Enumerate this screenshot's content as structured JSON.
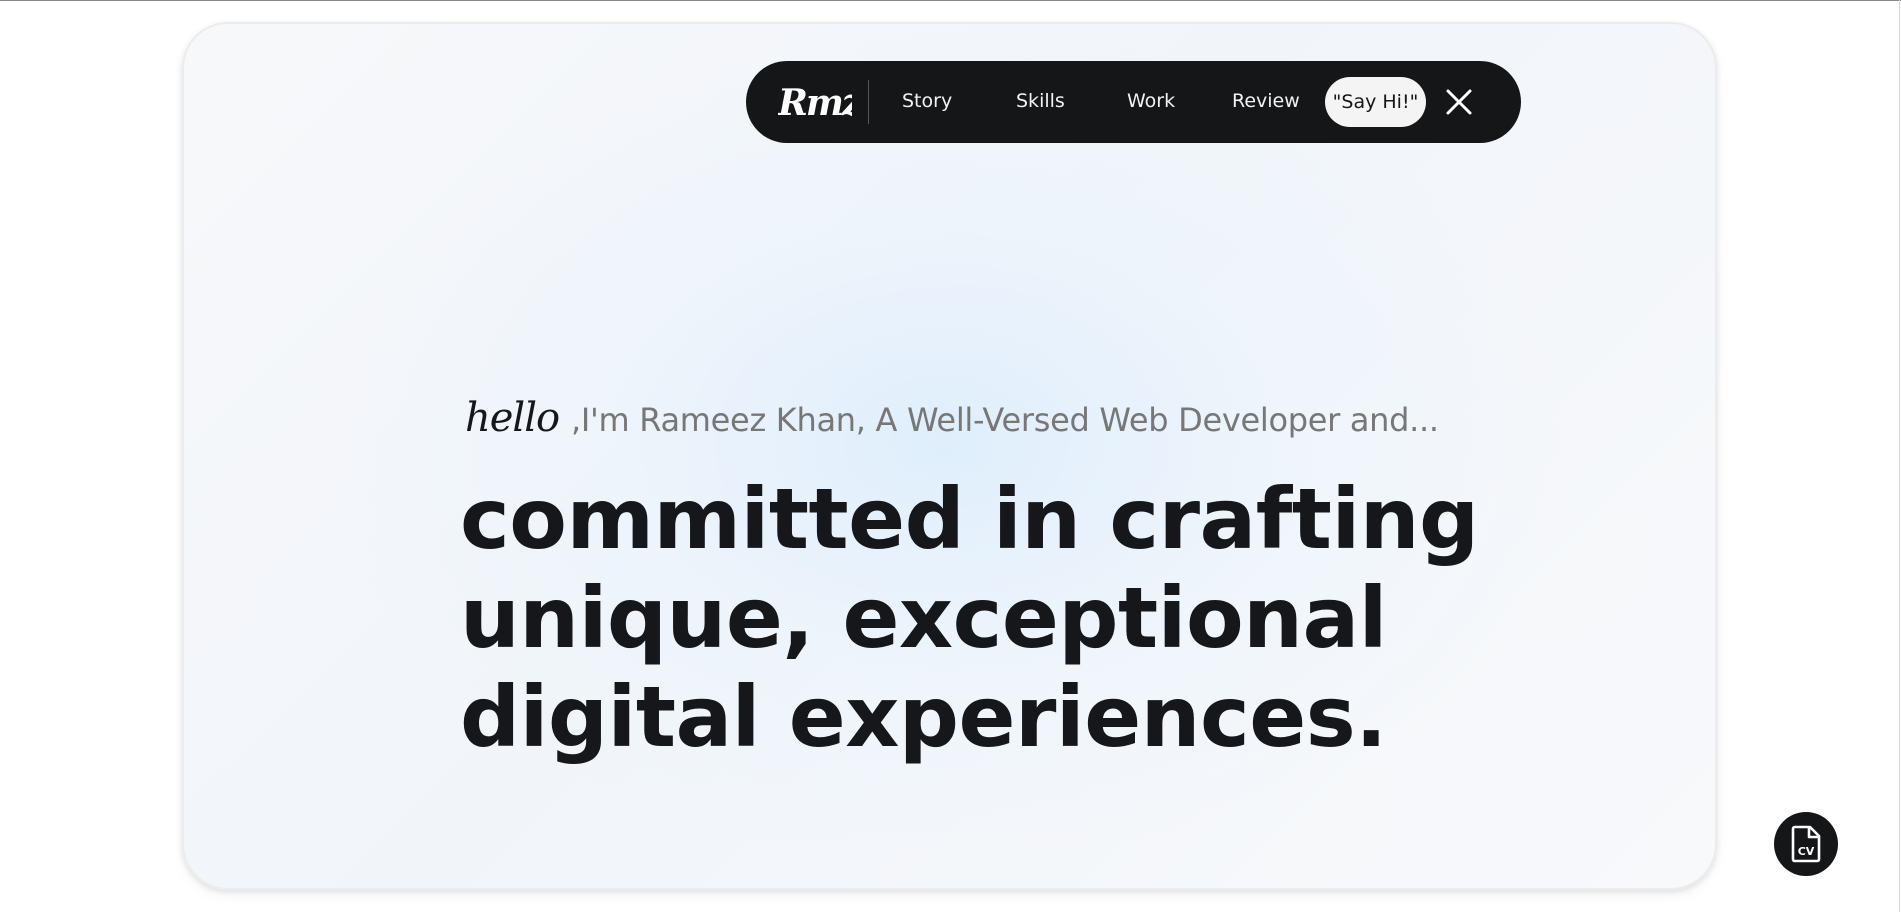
{
  "nav": {
    "logo_text": "Rmz",
    "items": [
      {
        "label": "Story"
      },
      {
        "label": "Skills"
      },
      {
        "label": "Work"
      },
      {
        "label": "Review"
      }
    ],
    "cta_label": "\"Say Hi!\"",
    "close_icon": "close-icon"
  },
  "hero": {
    "greeting_script": "hello",
    "intro": ",I'm Rameez Khan, A Well-Versed Web Developer and...",
    "headline": [
      "committed in crafting",
      "unique, exceptional",
      "digital experiences."
    ]
  },
  "floating": {
    "cv_icon": "cv-document-icon",
    "cv_text": "CV"
  },
  "colors": {
    "nav_bg": "#151618",
    "headline": "#15171a",
    "intro": "#777777",
    "card_tint": "#eaf3fc"
  }
}
